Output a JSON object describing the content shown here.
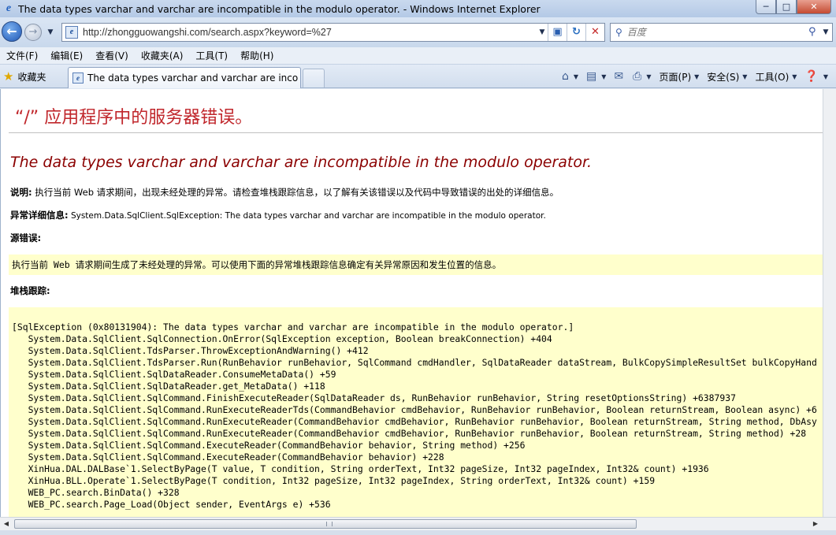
{
  "window": {
    "title": "The data types varchar and varchar are incompatible in the modulo operator. - Windows Internet Explorer",
    "icon": "ie-icon",
    "controls": [
      "minimize",
      "maximize",
      "close"
    ]
  },
  "navbar": {
    "url": "http://zhongguowangshi.com/search.aspx?keyword=%27",
    "search_placeholder": "百度"
  },
  "menu": [
    "文件(F)",
    "编辑(E)",
    "查看(V)",
    "收藏夹(A)",
    "工具(T)",
    "帮助(H)"
  ],
  "tabbar": {
    "favorites_label": "收藏夹",
    "active_tab": "The data types varchar and varchar are inco...",
    "commands": {
      "page": "页面(P)",
      "safety": "安全(S)",
      "tools": "工具(O)"
    }
  },
  "content": {
    "page_title": "“/” 应用程序中的服务器错误。",
    "error_message": "The data types varchar and varchar are incompatible in the modulo operator.",
    "description_label": "说明:",
    "description_text": " 执行当前 Web 请求期间，出现未经处理的异常。请检查堆栈跟踪信息，以了解有关该错误以及代码中导致错误的出处的详细信息。",
    "details_label": "异常详细信息:",
    "details_text": " System.Data.SqlClient.SqlException: The data types varchar and varchar are incompatible in the modulo operator.",
    "source_label": "源错误:",
    "source_text": "执行当前 Web 请求期间生成了未经处理的异常。可以使用下面的异常堆栈跟踪信息确定有关异常原因和发生位置的信息。",
    "stack_label": "堆栈跟踪:",
    "stack_lines": [
      "[SqlException (0x80131904): The data types varchar and varchar are incompatible in the modulo operator.]",
      "   System.Data.SqlClient.SqlConnection.OnError(SqlException exception, Boolean breakConnection) +404",
      "   System.Data.SqlClient.TdsParser.ThrowExceptionAndWarning() +412",
      "   System.Data.SqlClient.TdsParser.Run(RunBehavior runBehavior, SqlCommand cmdHandler, SqlDataReader dataStream, BulkCopySimpleResultSet bulkCopyHand",
      "   System.Data.SqlClient.SqlDataReader.ConsumeMetaData() +59",
      "   System.Data.SqlClient.SqlDataReader.get_MetaData() +118",
      "   System.Data.SqlClient.SqlCommand.FinishExecuteReader(SqlDataReader ds, RunBehavior runBehavior, String resetOptionsString) +6387937",
      "   System.Data.SqlClient.SqlCommand.RunExecuteReaderTds(CommandBehavior cmdBehavior, RunBehavior runBehavior, Boolean returnStream, Boolean async) +6",
      "   System.Data.SqlClient.SqlCommand.RunExecuteReader(CommandBehavior cmdBehavior, RunBehavior runBehavior, Boolean returnStream, String method, DbAsy",
      "   System.Data.SqlClient.SqlCommand.RunExecuteReader(CommandBehavior cmdBehavior, RunBehavior runBehavior, Boolean returnStream, String method) +28",
      "   System.Data.SqlClient.SqlCommand.ExecuteReader(CommandBehavior behavior, String method) +256",
      "   System.Data.SqlClient.SqlCommand.ExecuteReader(CommandBehavior behavior) +228",
      "   XinHua.DAL.DALBase`1.SelectByPage(T value, T condition, String orderText, Int32 pageSize, Int32 pageIndex, Int32& count) +1936",
      "   XinHua.BLL.Operate`1.SelectByPage(T condition, Int32 pageSize, Int32 pageIndex, String orderText, Int32& count) +159",
      "   WEB_PC.search.BinData() +328",
      "   WEB_PC.search.Page_Load(Object sender, EventArgs e) +536"
    ]
  },
  "colors": {
    "title_red": "#c0262b",
    "error_maroon": "#8b0000",
    "code_bg": "#ffffcc"
  }
}
